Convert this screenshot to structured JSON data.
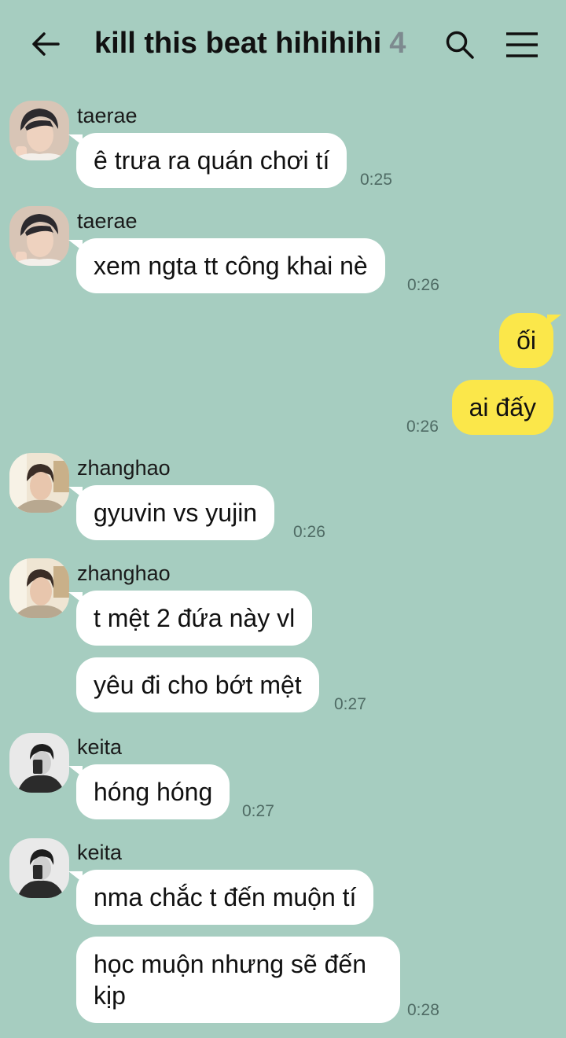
{
  "header": {
    "title": "kill this beat hihihihi",
    "member_count": "4"
  },
  "messages": [
    {
      "sender": "taerae",
      "text": "ê trưa ra quán chơi tí",
      "time": "0:25"
    },
    {
      "sender": "taerae",
      "text": "xem ngta tt công khai nè",
      "time": "0:26"
    },
    {
      "mine_1": "ối",
      "mine_2": "ai đấy",
      "time": "0:26"
    },
    {
      "sender": "zhanghao",
      "text": "gyuvin vs yujin",
      "time": "0:26"
    },
    {
      "sender": "zhanghao",
      "text": "t mệt 2 đứa này vl",
      "text2": "yêu đi cho bớt mệt",
      "time": "0:27"
    },
    {
      "sender": "keita",
      "text": "hóng hóng",
      "time": "0:27"
    },
    {
      "sender": "keita",
      "text": "nma chắc t đến muộn tí",
      "text2": "học muộn nhưng sẽ đến kịp",
      "time": "0:28"
    }
  ]
}
